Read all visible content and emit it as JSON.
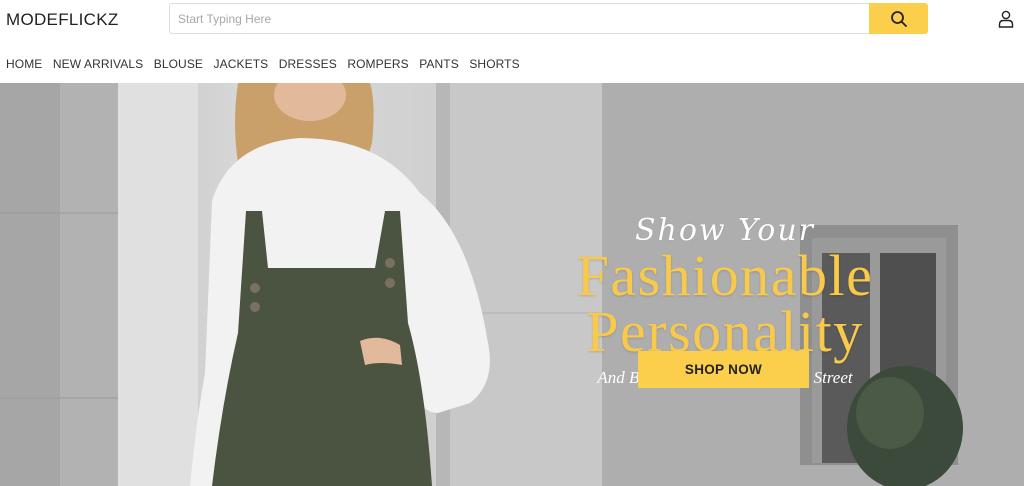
{
  "brand": {
    "logo": "MODEFLICKZ"
  },
  "search": {
    "placeholder": "Start Typing Here",
    "value": "",
    "button_icon": "search-icon"
  },
  "account": {
    "icon": "user-icon"
  },
  "nav": {
    "items": [
      {
        "label": "HOME"
      },
      {
        "label": "NEW ARRIVALS"
      },
      {
        "label": "BLOUSE"
      },
      {
        "label": "JACKETS"
      },
      {
        "label": "DRESSES"
      },
      {
        "label": "ROMPERS"
      },
      {
        "label": "PANTS"
      },
      {
        "label": "SHORTS"
      }
    ]
  },
  "hero": {
    "script_line": "Show Your",
    "headline_1": "Fashionable",
    "headline_2": "Personality",
    "subline": "And Become The Focus Of The Street",
    "cta": "SHOP NOW"
  },
  "colors": {
    "accent": "#fbcf4b",
    "headline": "#f8c94a",
    "text": "#222222"
  }
}
